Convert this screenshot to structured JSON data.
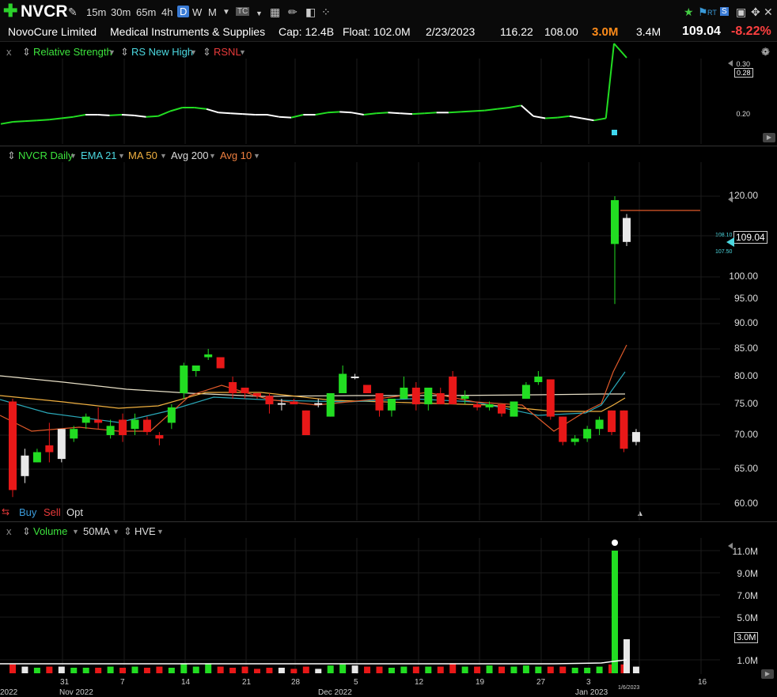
{
  "toolbar": {
    "symbol": "NVCR",
    "timeframes": [
      "15m",
      "30m",
      "65m",
      "4h",
      "D",
      "W",
      "M"
    ],
    "active_timeframe": "D",
    "rt_label": "RT",
    "icons": [
      "plus-icon",
      "wrench-icon",
      "dropdown-icon",
      "tc-icon",
      "calculator-icon",
      "pencil-icon",
      "layers-icon",
      "network-icon",
      "star-icon",
      "flag-icon",
      "rt-icon",
      "share-icon",
      "save-icon",
      "maximize-icon",
      "close-icon"
    ]
  },
  "info": {
    "company": "NovoCure Limited",
    "industry": "Medical Instruments & Supplies",
    "cap": "Cap: 12.4B",
    "float": "Float: 102.0M",
    "date": "2/23/2023",
    "high": "116.22",
    "low": "108.00",
    "volume": "3.0M",
    "avg_volume": "3.4M",
    "price": "109.04",
    "change": "-8.22%"
  },
  "rs_panel": {
    "close_label": "x",
    "items": [
      "Relative Strength",
      "RS New High",
      "RSNL"
    ],
    "y_labels": [
      "0.30",
      "0.20"
    ],
    "current_tag": "0.28"
  },
  "price_panel": {
    "items": [
      "NVCR Daily",
      "EMA 21",
      "MA 50",
      "Avg 200",
      "Avg 10"
    ],
    "y_labels": [
      "120.00",
      "110.00",
      "100.00",
      "95.00",
      "90.00",
      "85.00",
      "80.00",
      "75.00",
      "70.00",
      "65.00",
      "60.00"
    ],
    "price_tag": "109.04",
    "small_tags": [
      "108.10",
      "107.50"
    ],
    "buttons": [
      "Buy",
      "Sell",
      "Opt"
    ]
  },
  "volume_panel": {
    "close_label": "x",
    "items": [
      "Volume",
      "50MA",
      "HVE"
    ],
    "y_labels": [
      "11.0M",
      "9.0M",
      "7.0M",
      "5.0M",
      "1.0M"
    ],
    "current_tag": "3.0M"
  },
  "x_axis": {
    "days": [
      "31",
      "7",
      "14",
      "21",
      "28",
      "5",
      "12",
      "19",
      "27",
      "3",
      "1/6/2023",
      "16"
    ],
    "months": [
      "2022",
      "Nov 2022",
      "Dec 2022",
      "Jan 2023"
    ]
  },
  "colors": {
    "up": "#22dd22",
    "down": "#e81818",
    "accent": "#3a7bd5",
    "change": "#ff4040",
    "volume_hl": "#ff8c1a"
  },
  "chart_data": {
    "type": "candlestick",
    "title": "NVCR Daily",
    "candles": [
      {
        "o": 75.5,
        "h": 76,
        "l": 61,
        "c": 62,
        "dir": "down"
      },
      {
        "o": 64,
        "h": 68,
        "l": 63,
        "c": 67,
        "dir": "flat"
      },
      {
        "o": 66,
        "h": 68,
        "l": 66,
        "c": 67.5,
        "dir": "up"
      },
      {
        "o": 67.5,
        "h": 72,
        "l": 66,
        "c": 68.5,
        "dir": "down"
      },
      {
        "o": 66.5,
        "h": 71,
        "l": 66,
        "c": 71,
        "dir": "flat"
      },
      {
        "o": 69.5,
        "h": 71.5,
        "l": 69,
        "c": 71,
        "dir": "up"
      },
      {
        "o": 72,
        "h": 73.5,
        "l": 71,
        "c": 73,
        "dir": "up"
      },
      {
        "o": 72.5,
        "h": 74.5,
        "l": 71,
        "c": 72,
        "dir": "down"
      },
      {
        "o": 70,
        "h": 72.5,
        "l": 69.5,
        "c": 71.5,
        "dir": "up"
      },
      {
        "o": 72.5,
        "h": 73.5,
        "l": 69,
        "c": 70,
        "dir": "down"
      },
      {
        "o": 71,
        "h": 73.5,
        "l": 70,
        "c": 72.5,
        "dir": "up"
      },
      {
        "o": 72.5,
        "h": 73,
        "l": 70,
        "c": 70.5,
        "dir": "down"
      },
      {
        "o": 70,
        "h": 70.5,
        "l": 68.5,
        "c": 69.5,
        "dir": "down"
      },
      {
        "o": 72,
        "h": 75,
        "l": 71,
        "c": 74.5,
        "dir": "up"
      },
      {
        "o": 77,
        "h": 82.5,
        "l": 76,
        "c": 82,
        "dir": "up"
      },
      {
        "o": 81,
        "h": 82,
        "l": 80,
        "c": 82,
        "dir": "up"
      },
      {
        "o": 83.5,
        "h": 85,
        "l": 83,
        "c": 84,
        "dir": "up"
      },
      {
        "o": 83.5,
        "h": 83.5,
        "l": 81.5,
        "c": 81.5,
        "dir": "down"
      },
      {
        "o": 79,
        "h": 80,
        "l": 76,
        "c": 77,
        "dir": "down"
      },
      {
        "o": 78,
        "h": 78,
        "l": 76,
        "c": 77,
        "dir": "down"
      },
      {
        "o": 77,
        "h": 77,
        "l": 76,
        "c": 76.5,
        "dir": "down"
      },
      {
        "o": 76.5,
        "h": 77,
        "l": 73.5,
        "c": 75,
        "dir": "down"
      },
      {
        "o": 75,
        "h": 76,
        "l": 74,
        "c": 75.2,
        "dir": "flat"
      },
      {
        "o": 75.5,
        "h": 76,
        "l": 75,
        "c": 75,
        "dir": "down"
      },
      {
        "o": 74,
        "h": 74,
        "l": 70,
        "c": 70,
        "dir": "down"
      },
      {
        "o": 75,
        "h": 76,
        "l": 74.5,
        "c": 75.2,
        "dir": "flat"
      },
      {
        "o": 73,
        "h": 76,
        "l": 73,
        "c": 77,
        "dir": "up"
      },
      {
        "o": 77,
        "h": 82,
        "l": 77,
        "c": 80.5,
        "dir": "up"
      },
      {
        "o": 80,
        "h": 80.5,
        "l": 79.5,
        "c": 80,
        "dir": "flat"
      },
      {
        "o": 78.5,
        "h": 78.5,
        "l": 77,
        "c": 77,
        "dir": "down"
      },
      {
        "o": 77,
        "h": 77,
        "l": 73,
        "c": 74,
        "dir": "down"
      },
      {
        "o": 74,
        "h": 76,
        "l": 73,
        "c": 76,
        "dir": "up"
      },
      {
        "o": 76,
        "h": 80,
        "l": 76,
        "c": 78,
        "dir": "up"
      },
      {
        "o": 78,
        "h": 79,
        "l": 74,
        "c": 75,
        "dir": "down"
      },
      {
        "o": 75,
        "h": 78,
        "l": 74,
        "c": 78,
        "dir": "up"
      },
      {
        "o": 77,
        "h": 78,
        "l": 75,
        "c": 75,
        "dir": "down"
      },
      {
        "o": 75,
        "h": 81,
        "l": 75,
        "c": 80,
        "dir": "down"
      },
      {
        "o": 76,
        "h": 77.5,
        "l": 75,
        "c": 76.5,
        "dir": "up"
      },
      {
        "o": 75,
        "h": 75.5,
        "l": 74,
        "c": 74.5,
        "dir": "down"
      },
      {
        "o": 74.5,
        "h": 75.5,
        "l": 74,
        "c": 75,
        "dir": "up"
      },
      {
        "o": 75,
        "h": 75,
        "l": 73,
        "c": 73.5,
        "dir": "down"
      },
      {
        "o": 73,
        "h": 75.5,
        "l": 73,
        "c": 75.5,
        "dir": "up"
      },
      {
        "o": 76,
        "h": 79,
        "l": 76,
        "c": 78.5,
        "dir": "up"
      },
      {
        "o": 79,
        "h": 81,
        "l": 78.5,
        "c": 80,
        "dir": "up"
      },
      {
        "o": 79.5,
        "h": 79.5,
        "l": 72.5,
        "c": 73,
        "dir": "down"
      },
      {
        "o": 73,
        "h": 73,
        "l": 68.5,
        "c": 69,
        "dir": "down"
      },
      {
        "o": 69,
        "h": 70,
        "l": 68.5,
        "c": 69.5,
        "dir": "up"
      },
      {
        "o": 69.5,
        "h": 71.5,
        "l": 69,
        "c": 71,
        "dir": "up"
      },
      {
        "o": 71,
        "h": 73,
        "l": 70,
        "c": 72.5,
        "dir": "up"
      },
      {
        "o": 74,
        "h": 74,
        "l": 70,
        "c": 70.5,
        "dir": "down"
      },
      {
        "o": 74,
        "h": 74,
        "l": 67.5,
        "c": 68,
        "dir": "down"
      },
      {
        "o": 69,
        "h": 71,
        "l": 68.5,
        "c": 70.5,
        "dir": "flat"
      },
      {
        "o": 108,
        "h": 120,
        "l": 94,
        "c": 119,
        "dir": "up"
      },
      {
        "o": 108.5,
        "h": 115.5,
        "l": 107.5,
        "c": 114.5,
        "dir": "flat"
      }
    ],
    "volume_millions": [
      0.8,
      0.6,
      0.5,
      0.6,
      0.6,
      0.5,
      0.5,
      0.5,
      0.6,
      0.5,
      0.6,
      0.5,
      0.6,
      0.5,
      0.9,
      0.6,
      0.9,
      0.6,
      0.5,
      0.6,
      0.4,
      0.5,
      0.5,
      0.4,
      0.6,
      0.4,
      0.7,
      0.8,
      0.7,
      0.6,
      0.6,
      0.5,
      0.6,
      0.6,
      0.6,
      0.6,
      0.9,
      0.6,
      0.6,
      0.7,
      0.6,
      0.6,
      0.7,
      0.6,
      0.6,
      0.6,
      0.5,
      0.5,
      0.6,
      0.8,
      0.8,
      0.6,
      11.0,
      3.0
    ],
    "rs_values": [
      0.187,
      0.19,
      0.191,
      0.192,
      0.193,
      0.195,
      0.197,
      0.2,
      0.2,
      0.199,
      0.2,
      0.199,
      0.197,
      0.198,
      0.205,
      0.21,
      0.21,
      0.208,
      0.203,
      0.202,
      0.201,
      0.2,
      0.2,
      0.197,
      0.196,
      0.2,
      0.2,
      0.203,
      0.204,
      0.203,
      0.2,
      0.202,
      0.203,
      0.202,
      0.201,
      0.202,
      0.203,
      0.203,
      0.204,
      0.205,
      0.206,
      0.208,
      0.21,
      0.213,
      0.198,
      0.195,
      0.196,
      0.198,
      0.195,
      0.192,
      0.195,
      0.3,
      0.28
    ],
    "ylim": [
      58,
      125
    ],
    "y_axis_label": "",
    "grid": true
  }
}
